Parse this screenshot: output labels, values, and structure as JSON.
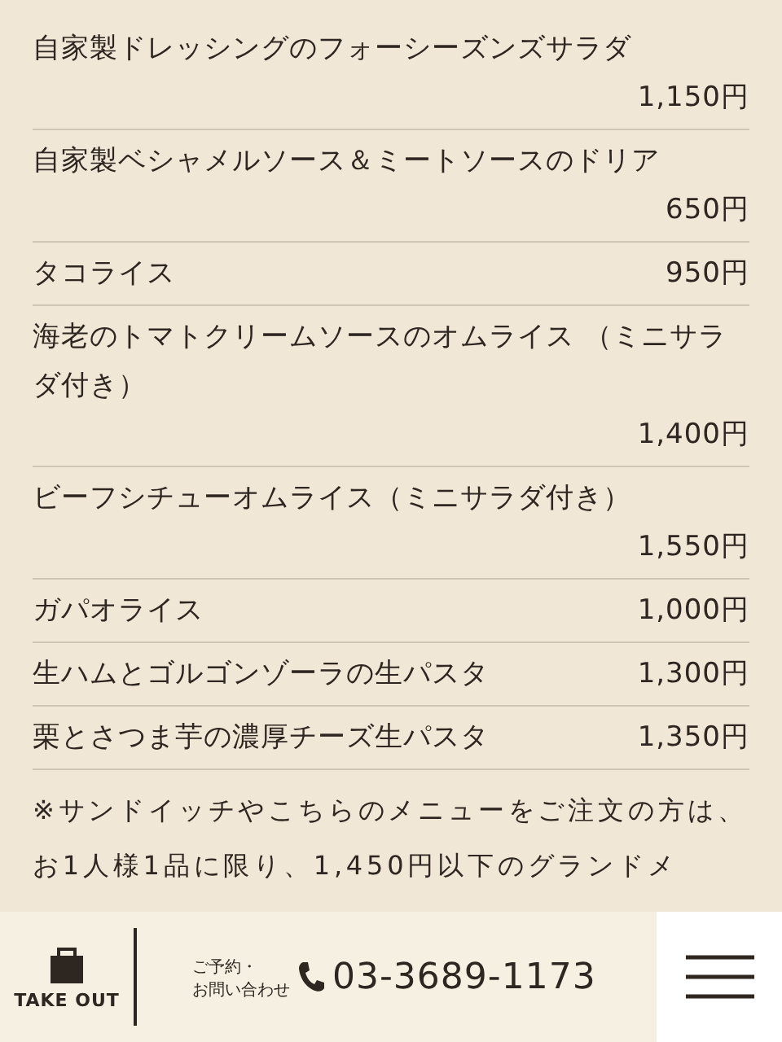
{
  "menu_items": [
    {
      "name": "自家製ドレッシングのフォーシーズンズサラダ",
      "price": "1,150円",
      "kind": "price_below"
    },
    {
      "name": "自家製ベシャメルソース＆ミートソースのドリア",
      "price": "650円",
      "kind": "price_below"
    },
    {
      "name": "タコライス",
      "price": "950円",
      "kind": "price_inline"
    },
    {
      "name": "海老のトマトクリームソースのオムライス （ミニサラダ付き）",
      "price": "1,400円",
      "kind": "price_below"
    },
    {
      "name": "ビーフシチューオムライス（ミニサラダ付き）",
      "price": "1,550円",
      "kind": "price_below"
    },
    {
      "name": "ガパオライス",
      "price": "1,000円",
      "kind": "price_inline"
    },
    {
      "name": "生ハムとゴルゴンゾーラの生パスタ",
      "price": "1,300円",
      "kind": "price_inline"
    },
    {
      "name": "栗とさつま芋の濃厚チーズ生パスタ",
      "price": "1,350円",
      "kind": "price_inline"
    }
  ],
  "note": "※サンドイッチやこちらのメニューをご注文の方は、お1人様1品に限り、1,450円以下のグランドメ",
  "bottom_bar": {
    "takeout_label": "TAKE OUT",
    "contact_label_1": "ご予約・",
    "contact_label_2": "お問い合わせ",
    "phone": "03-3689-1173"
  }
}
